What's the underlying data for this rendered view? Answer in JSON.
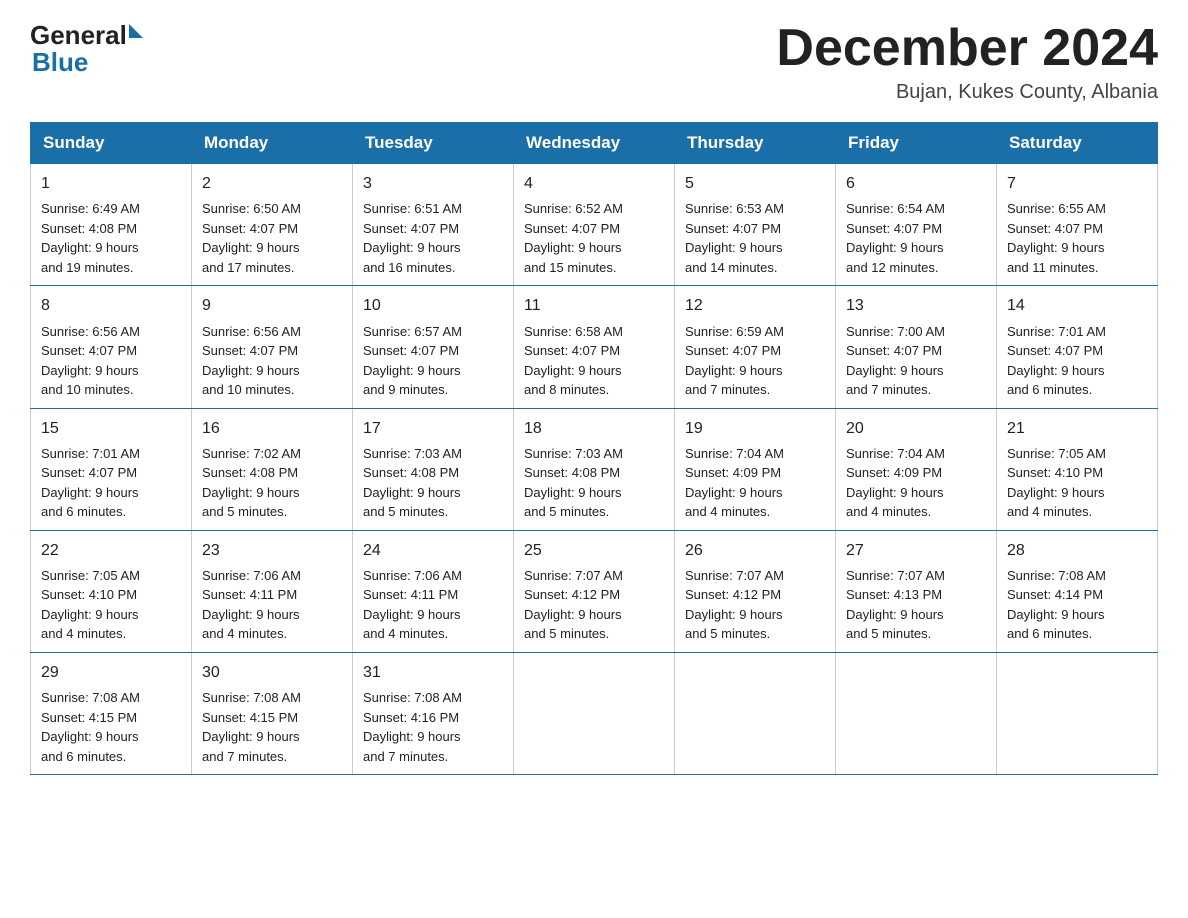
{
  "logo": {
    "general": "General",
    "blue": "Blue"
  },
  "header": {
    "month": "December 2024",
    "location": "Bujan, Kukes County, Albania"
  },
  "days_of_week": [
    "Sunday",
    "Monday",
    "Tuesday",
    "Wednesday",
    "Thursday",
    "Friday",
    "Saturday"
  ],
  "weeks": [
    [
      {
        "num": "1",
        "sunrise": "6:49 AM",
        "sunset": "4:08 PM",
        "daylight": "9 hours and 19 minutes."
      },
      {
        "num": "2",
        "sunrise": "6:50 AM",
        "sunset": "4:07 PM",
        "daylight": "9 hours and 17 minutes."
      },
      {
        "num": "3",
        "sunrise": "6:51 AM",
        "sunset": "4:07 PM",
        "daylight": "9 hours and 16 minutes."
      },
      {
        "num": "4",
        "sunrise": "6:52 AM",
        "sunset": "4:07 PM",
        "daylight": "9 hours and 15 minutes."
      },
      {
        "num": "5",
        "sunrise": "6:53 AM",
        "sunset": "4:07 PM",
        "daylight": "9 hours and 14 minutes."
      },
      {
        "num": "6",
        "sunrise": "6:54 AM",
        "sunset": "4:07 PM",
        "daylight": "9 hours and 12 minutes."
      },
      {
        "num": "7",
        "sunrise": "6:55 AM",
        "sunset": "4:07 PM",
        "daylight": "9 hours and 11 minutes."
      }
    ],
    [
      {
        "num": "8",
        "sunrise": "6:56 AM",
        "sunset": "4:07 PM",
        "daylight": "9 hours and 10 minutes."
      },
      {
        "num": "9",
        "sunrise": "6:56 AM",
        "sunset": "4:07 PM",
        "daylight": "9 hours and 10 minutes."
      },
      {
        "num": "10",
        "sunrise": "6:57 AM",
        "sunset": "4:07 PM",
        "daylight": "9 hours and 9 minutes."
      },
      {
        "num": "11",
        "sunrise": "6:58 AM",
        "sunset": "4:07 PM",
        "daylight": "9 hours and 8 minutes."
      },
      {
        "num": "12",
        "sunrise": "6:59 AM",
        "sunset": "4:07 PM",
        "daylight": "9 hours and 7 minutes."
      },
      {
        "num": "13",
        "sunrise": "7:00 AM",
        "sunset": "4:07 PM",
        "daylight": "9 hours and 7 minutes."
      },
      {
        "num": "14",
        "sunrise": "7:01 AM",
        "sunset": "4:07 PM",
        "daylight": "9 hours and 6 minutes."
      }
    ],
    [
      {
        "num": "15",
        "sunrise": "7:01 AM",
        "sunset": "4:07 PM",
        "daylight": "9 hours and 6 minutes."
      },
      {
        "num": "16",
        "sunrise": "7:02 AM",
        "sunset": "4:08 PM",
        "daylight": "9 hours and 5 minutes."
      },
      {
        "num": "17",
        "sunrise": "7:03 AM",
        "sunset": "4:08 PM",
        "daylight": "9 hours and 5 minutes."
      },
      {
        "num": "18",
        "sunrise": "7:03 AM",
        "sunset": "4:08 PM",
        "daylight": "9 hours and 5 minutes."
      },
      {
        "num": "19",
        "sunrise": "7:04 AM",
        "sunset": "4:09 PM",
        "daylight": "9 hours and 4 minutes."
      },
      {
        "num": "20",
        "sunrise": "7:04 AM",
        "sunset": "4:09 PM",
        "daylight": "9 hours and 4 minutes."
      },
      {
        "num": "21",
        "sunrise": "7:05 AM",
        "sunset": "4:10 PM",
        "daylight": "9 hours and 4 minutes."
      }
    ],
    [
      {
        "num": "22",
        "sunrise": "7:05 AM",
        "sunset": "4:10 PM",
        "daylight": "9 hours and 4 minutes."
      },
      {
        "num": "23",
        "sunrise": "7:06 AM",
        "sunset": "4:11 PM",
        "daylight": "9 hours and 4 minutes."
      },
      {
        "num": "24",
        "sunrise": "7:06 AM",
        "sunset": "4:11 PM",
        "daylight": "9 hours and 4 minutes."
      },
      {
        "num": "25",
        "sunrise": "7:07 AM",
        "sunset": "4:12 PM",
        "daylight": "9 hours and 5 minutes."
      },
      {
        "num": "26",
        "sunrise": "7:07 AM",
        "sunset": "4:12 PM",
        "daylight": "9 hours and 5 minutes."
      },
      {
        "num": "27",
        "sunrise": "7:07 AM",
        "sunset": "4:13 PM",
        "daylight": "9 hours and 5 minutes."
      },
      {
        "num": "28",
        "sunrise": "7:08 AM",
        "sunset": "4:14 PM",
        "daylight": "9 hours and 6 minutes."
      }
    ],
    [
      {
        "num": "29",
        "sunrise": "7:08 AM",
        "sunset": "4:15 PM",
        "daylight": "9 hours and 6 minutes."
      },
      {
        "num": "30",
        "sunrise": "7:08 AM",
        "sunset": "4:15 PM",
        "daylight": "9 hours and 7 minutes."
      },
      {
        "num": "31",
        "sunrise": "7:08 AM",
        "sunset": "4:16 PM",
        "daylight": "9 hours and 7 minutes."
      },
      null,
      null,
      null,
      null
    ]
  ],
  "labels": {
    "sunrise": "Sunrise:",
    "sunset": "Sunset:",
    "daylight": "Daylight:"
  }
}
